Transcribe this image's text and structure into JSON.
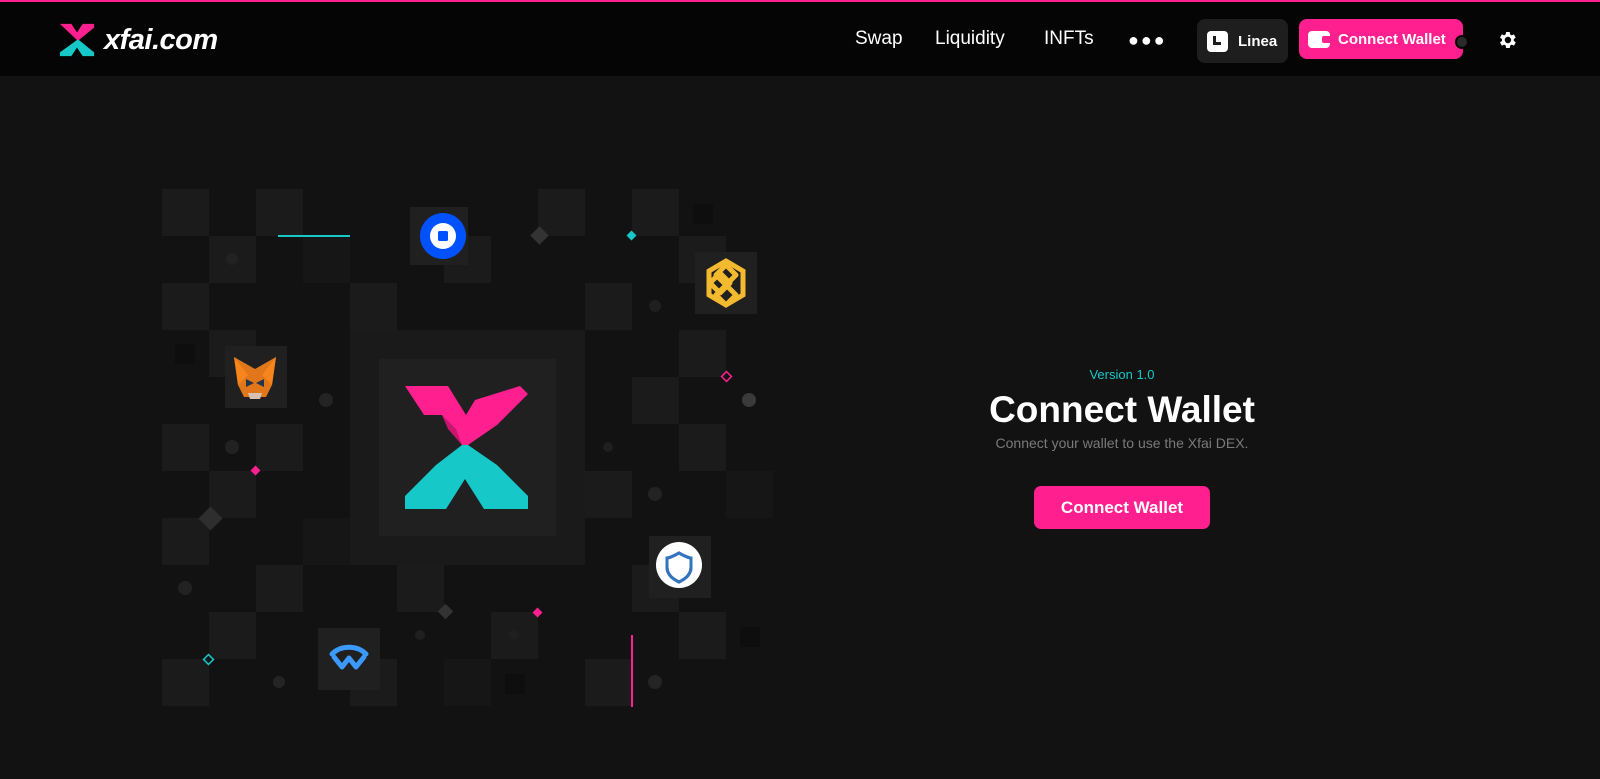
{
  "brand": {
    "name": "xfai.com",
    "pink": "#ff1f8f",
    "teal": "#17c8c8"
  },
  "nav": {
    "links": [
      "Swap",
      "Liquidity",
      "INFTs"
    ],
    "more_icon": "more-horizontal-icon",
    "network": {
      "label": "Linea",
      "icon": "linea-icon"
    },
    "connect_label": "Connect Wallet",
    "connect_icon": "wallet-icon",
    "settings_icon": "gear-icon"
  },
  "illustration": {
    "center_logo": "xfai-logo",
    "wallets": [
      "coinbase-wallet-icon",
      "binance-wallet-icon",
      "metamask-icon",
      "trust-wallet-icon",
      "walletconnect-icon"
    ]
  },
  "main": {
    "version": "Version 1.0",
    "title": "Connect Wallet",
    "subtitle": "Connect your wallet to use the Xfai DEX.",
    "connect_label": "Connect Wallet"
  }
}
